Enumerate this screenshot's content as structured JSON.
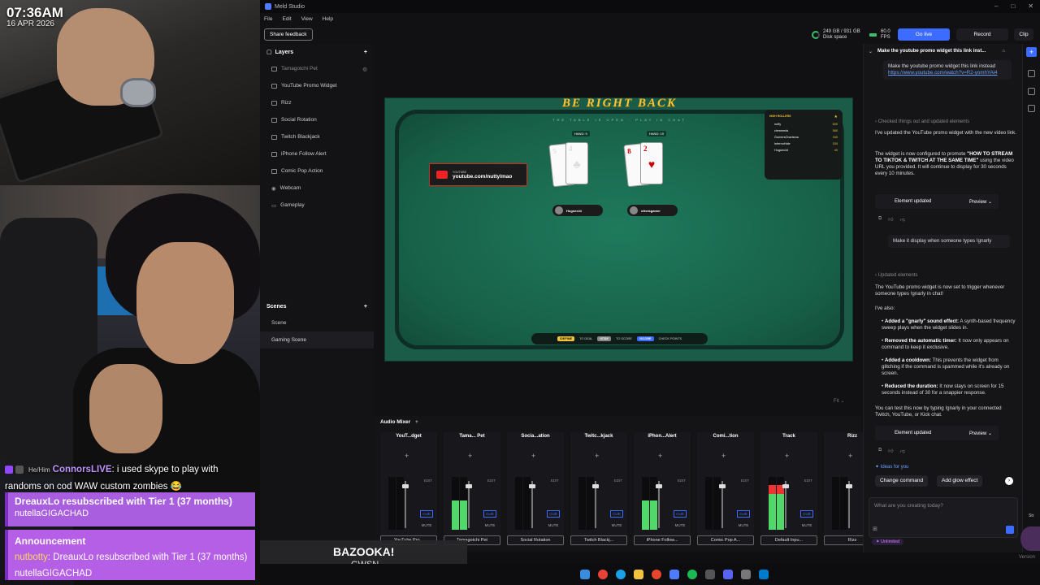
{
  "overlay": {
    "time": "07:36AM",
    "date": "16 APR 2026",
    "chat": {
      "pronouns": "He/Him",
      "user": "ConnorsLIVE",
      "message": ": i used skype to play with randoms on cod WAW custom zombies 😂"
    },
    "sub_alert": {
      "title": "DreauxLo resubscribed with Tier 1 (37 months)",
      "user": "nutellaGIGACHAD"
    },
    "announcement": {
      "title": "Announcement",
      "user": "nutbotty",
      "message": ": DreauxLo resubscribed with Tier 1 (37 months)",
      "reply_user": "nutellaGIGACHAD"
    },
    "now_playing": {
      "title": "BAZOOKA!",
      "artist": "GWSN"
    },
    "side_label": "Str"
  },
  "app": {
    "title": "Meld Studio",
    "menu": [
      "File",
      "Edit",
      "View",
      "Help"
    ],
    "toolbar": {
      "share_feedback": "Share feedback",
      "disk_line1": "249 GB / 931 GB",
      "disk_line2": "Disk space",
      "fps_value": "60.0",
      "fps_label": "FPS",
      "go_live": "Go live",
      "record": "Record",
      "clip": "Clip"
    },
    "layers": {
      "title": "Layers",
      "items": [
        "Tamagotchi Pet",
        "YouTube Promo Widget",
        "Rizz",
        "Social Rotation",
        "Twitch Blackjack",
        "iPhone Follow Alert",
        "Comic Pop Action",
        "Webcam",
        "Gameplay"
      ]
    },
    "scenes": {
      "title": "Scenes",
      "items": [
        "Scene",
        "Gaming Scene"
      ]
    },
    "preview": {
      "headline": "BE RIGHT BACK",
      "subtitle": "THE TABLE IS OPEN · PLAY IN CHAT",
      "yt_label": "YOUTUBE",
      "yt_url": "youtube.com/nuttylmao",
      "hand1": "HAND: 9",
      "hand2": "HAND: 19",
      "card1a": "5",
      "card1b": "4",
      "card1suit": "♣",
      "card2a": "8",
      "card2b": "2",
      "card2suit": "♥",
      "player1": "Hogsex44",
      "player2": "ofenisgamer",
      "high_rollers_title": "HIGH ROLLERS",
      "high_rollers": [
        {
          "name": "nuffy",
          "value": "600"
        },
        {
          "name": "clemmeds",
          "value": "560"
        },
        {
          "name": "GomersCharisma",
          "value": "160"
        },
        {
          "name": "InfernoHole",
          "value": "150"
        },
        {
          "name": "Hogsex44",
          "value": "40"
        }
      ],
      "legend": [
        {
          "key": "!DEFINE",
          "text": "TO DEAL"
        },
        {
          "key": "!STAY",
          "text": "TO SCORE"
        },
        {
          "key": "!SCORE",
          "text": "CHECK POINTS"
        }
      ],
      "fit": "Fit"
    },
    "mixer": {
      "title": "Audio Mixer",
      "channels": [
        {
          "name": "YouT...dget",
          "source": "YouTube Pro...",
          "level": 0.0
        },
        {
          "name": "Tama... Pet",
          "source": "Tamagotchi Pet",
          "level": 0.55
        },
        {
          "name": "Socia...ation",
          "source": "Social Rotation",
          "level": 0.0
        },
        {
          "name": "Twitc...kjack",
          "source": "Twitch Blackj...",
          "level": 0.0
        },
        {
          "name": "iPhon...Alert",
          "source": "iPhone Follow...",
          "level": 0.55
        },
        {
          "name": "Comi...tion",
          "source": "Comic Pop A...",
          "level": 0.0
        },
        {
          "name": "Track",
          "source": "Default Inpu...",
          "level": 0.85
        },
        {
          "name": "Rizz",
          "source": "Rizz",
          "level": 0.0
        }
      ],
      "edit": "EDIT",
      "cue": "CUE",
      "mute": "MUTE"
    },
    "assistant": {
      "title": "Make the youtube promo widget this link inst...",
      "msg1": "Make the youtube promo widget this link instead",
      "link": "https://www.youtube.com/watch?v=R2-yomhYAi4",
      "step1": "Checked things out and updated elements",
      "resp1a": "I've updated the YouTube promo widget with the new video link.",
      "resp1b_pre": "The widget is now configured to promote ",
      "resp1b_bold": "\"HOW TO STREAM TO TIKTOK & TWITCH AT THE SAME TIME\"",
      "resp1b_post": " using the video URL you provided. It will continue to display for 30 seconds every 10 minutes.",
      "element_updated": "Element updated",
      "preview": "Preview",
      "msg2": "Make it display when someone types !gnarly",
      "step2": "Updated elements",
      "resp2a": "The YouTube promo widget is now set to trigger whenever someone types !gnarly in chat!",
      "resp2b": "I've also:",
      "bullets": [
        {
          "bold": "Added a \"gnarly\" sound effect:",
          "text": " A synth-based frequency sweep plays when the widget slides in."
        },
        {
          "bold": "Removed the automatic timer:",
          "text": " It now only appears on command to keep it exclusive."
        },
        {
          "bold": "Added a cooldown:",
          "text": " This prevents the widget from glitching if the command is spammed while it's already on screen."
        },
        {
          "bold": "Reduced the duration:",
          "text": " It now stays on screen for 15 seconds instead of 30 for a snappier response."
        }
      ],
      "resp2c": "You can test this now by typing !gnarly in your connected Twitch, YouTube, or Kick chat.",
      "ideas": "Ideas for you",
      "chip1": "Change command",
      "chip2": "Add glow effect",
      "input_placeholder": "What are you creating today?",
      "unlimited": "Unlimited"
    },
    "version": "Version"
  }
}
